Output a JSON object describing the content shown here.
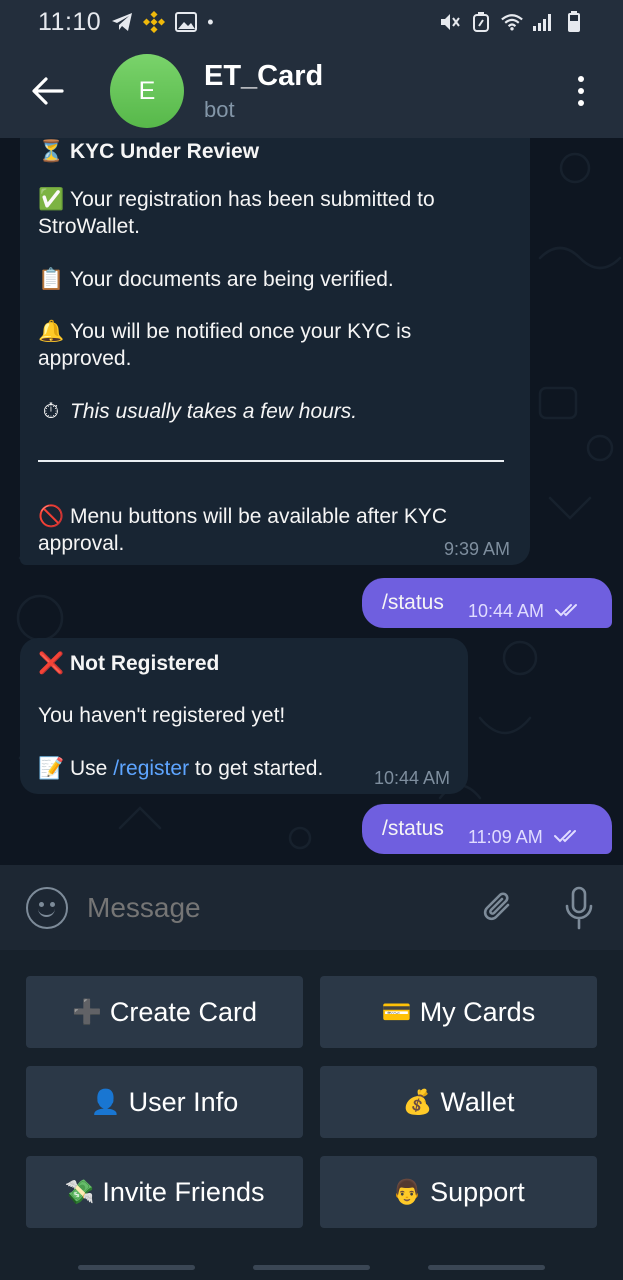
{
  "status_bar": {
    "time": "11:10",
    "dot": "•"
  },
  "header": {
    "avatar_letter": "E",
    "title": "ET_Card",
    "subtitle": "bot"
  },
  "messages": {
    "kyc": {
      "heading_emoji": "⏳",
      "heading": "KYC Under Review",
      "line1_emoji": "✅",
      "line1a": "Your registration has been submitted to",
      "line1b": "StroWallet.",
      "line2_emoji": "📋",
      "line2": "Your documents are being verified.",
      "line3_emoji": "🔔",
      "line3a": "You will be notified once your KYC is",
      "line3b": "approved.",
      "line4_emoji": "⏱",
      "line4": "This usually takes a few hours.",
      "line5_emoji": "🚫",
      "line5a": "Menu buttons will be available after KYC",
      "line5b": "approval.",
      "time": "9:39 AM"
    },
    "out1": {
      "text": "/status",
      "time": "10:44 AM"
    },
    "notreg": {
      "heading_emoji": "❌",
      "heading": "Not Registered",
      "line1": "You haven't registered yet!",
      "line2_emoji": "📝",
      "line2_pre": "Use",
      "line2_link": "/register",
      "line2_post": "to get started.",
      "time": "10:44 AM"
    },
    "out2": {
      "text": "/status",
      "time": "11:09 AM"
    }
  },
  "input": {
    "placeholder": "Message"
  },
  "keyboard": {
    "create_card_icon": "➕",
    "create_card": "Create Card",
    "my_cards_icon": "💳",
    "my_cards": "My Cards",
    "user_info_icon": "👤",
    "user_info": "User Info",
    "wallet_icon": "💰",
    "wallet": "Wallet",
    "invite_icon": "💸",
    "invite": "Invite Friends",
    "support_icon": "👨",
    "support": "Support"
  },
  "colors": {
    "outgoing_bubble": "#6f5fdf",
    "incoming_bubble": "#182533",
    "chat_background": "#0e1621",
    "header": "#232e3c",
    "link": "#5ea5ff",
    "avatar": "#5cbc4f"
  }
}
